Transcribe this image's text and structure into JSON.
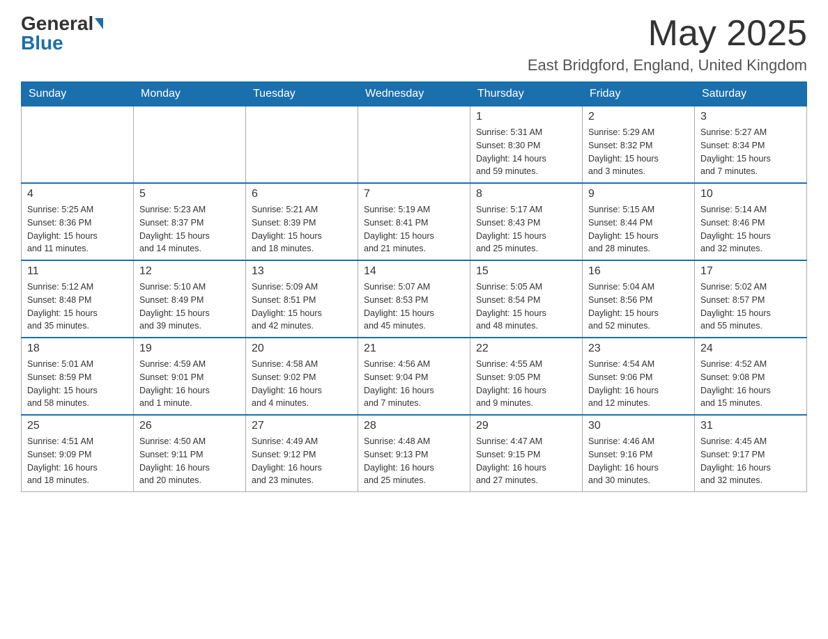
{
  "header": {
    "logo": {
      "general": "General",
      "blue": "Blue",
      "tagline": ""
    },
    "title": "May 2025",
    "location": "East Bridgford, England, United Kingdom"
  },
  "calendar": {
    "days_of_week": [
      "Sunday",
      "Monday",
      "Tuesday",
      "Wednesday",
      "Thursday",
      "Friday",
      "Saturday"
    ],
    "weeks": [
      [
        {
          "day": "",
          "info": ""
        },
        {
          "day": "",
          "info": ""
        },
        {
          "day": "",
          "info": ""
        },
        {
          "day": "",
          "info": ""
        },
        {
          "day": "1",
          "info": "Sunrise: 5:31 AM\nSunset: 8:30 PM\nDaylight: 14 hours\nand 59 minutes."
        },
        {
          "day": "2",
          "info": "Sunrise: 5:29 AM\nSunset: 8:32 PM\nDaylight: 15 hours\nand 3 minutes."
        },
        {
          "day": "3",
          "info": "Sunrise: 5:27 AM\nSunset: 8:34 PM\nDaylight: 15 hours\nand 7 minutes."
        }
      ],
      [
        {
          "day": "4",
          "info": "Sunrise: 5:25 AM\nSunset: 8:36 PM\nDaylight: 15 hours\nand 11 minutes."
        },
        {
          "day": "5",
          "info": "Sunrise: 5:23 AM\nSunset: 8:37 PM\nDaylight: 15 hours\nand 14 minutes."
        },
        {
          "day": "6",
          "info": "Sunrise: 5:21 AM\nSunset: 8:39 PM\nDaylight: 15 hours\nand 18 minutes."
        },
        {
          "day": "7",
          "info": "Sunrise: 5:19 AM\nSunset: 8:41 PM\nDaylight: 15 hours\nand 21 minutes."
        },
        {
          "day": "8",
          "info": "Sunrise: 5:17 AM\nSunset: 8:43 PM\nDaylight: 15 hours\nand 25 minutes."
        },
        {
          "day": "9",
          "info": "Sunrise: 5:15 AM\nSunset: 8:44 PM\nDaylight: 15 hours\nand 28 minutes."
        },
        {
          "day": "10",
          "info": "Sunrise: 5:14 AM\nSunset: 8:46 PM\nDaylight: 15 hours\nand 32 minutes."
        }
      ],
      [
        {
          "day": "11",
          "info": "Sunrise: 5:12 AM\nSunset: 8:48 PM\nDaylight: 15 hours\nand 35 minutes."
        },
        {
          "day": "12",
          "info": "Sunrise: 5:10 AM\nSunset: 8:49 PM\nDaylight: 15 hours\nand 39 minutes."
        },
        {
          "day": "13",
          "info": "Sunrise: 5:09 AM\nSunset: 8:51 PM\nDaylight: 15 hours\nand 42 minutes."
        },
        {
          "day": "14",
          "info": "Sunrise: 5:07 AM\nSunset: 8:53 PM\nDaylight: 15 hours\nand 45 minutes."
        },
        {
          "day": "15",
          "info": "Sunrise: 5:05 AM\nSunset: 8:54 PM\nDaylight: 15 hours\nand 48 minutes."
        },
        {
          "day": "16",
          "info": "Sunrise: 5:04 AM\nSunset: 8:56 PM\nDaylight: 15 hours\nand 52 minutes."
        },
        {
          "day": "17",
          "info": "Sunrise: 5:02 AM\nSunset: 8:57 PM\nDaylight: 15 hours\nand 55 minutes."
        }
      ],
      [
        {
          "day": "18",
          "info": "Sunrise: 5:01 AM\nSunset: 8:59 PM\nDaylight: 15 hours\nand 58 minutes."
        },
        {
          "day": "19",
          "info": "Sunrise: 4:59 AM\nSunset: 9:01 PM\nDaylight: 16 hours\nand 1 minute."
        },
        {
          "day": "20",
          "info": "Sunrise: 4:58 AM\nSunset: 9:02 PM\nDaylight: 16 hours\nand 4 minutes."
        },
        {
          "day": "21",
          "info": "Sunrise: 4:56 AM\nSunset: 9:04 PM\nDaylight: 16 hours\nand 7 minutes."
        },
        {
          "day": "22",
          "info": "Sunrise: 4:55 AM\nSunset: 9:05 PM\nDaylight: 16 hours\nand 9 minutes."
        },
        {
          "day": "23",
          "info": "Sunrise: 4:54 AM\nSunset: 9:06 PM\nDaylight: 16 hours\nand 12 minutes."
        },
        {
          "day": "24",
          "info": "Sunrise: 4:52 AM\nSunset: 9:08 PM\nDaylight: 16 hours\nand 15 minutes."
        }
      ],
      [
        {
          "day": "25",
          "info": "Sunrise: 4:51 AM\nSunset: 9:09 PM\nDaylight: 16 hours\nand 18 minutes."
        },
        {
          "day": "26",
          "info": "Sunrise: 4:50 AM\nSunset: 9:11 PM\nDaylight: 16 hours\nand 20 minutes."
        },
        {
          "day": "27",
          "info": "Sunrise: 4:49 AM\nSunset: 9:12 PM\nDaylight: 16 hours\nand 23 minutes."
        },
        {
          "day": "28",
          "info": "Sunrise: 4:48 AM\nSunset: 9:13 PM\nDaylight: 16 hours\nand 25 minutes."
        },
        {
          "day": "29",
          "info": "Sunrise: 4:47 AM\nSunset: 9:15 PM\nDaylight: 16 hours\nand 27 minutes."
        },
        {
          "day": "30",
          "info": "Sunrise: 4:46 AM\nSunset: 9:16 PM\nDaylight: 16 hours\nand 30 minutes."
        },
        {
          "day": "31",
          "info": "Sunrise: 4:45 AM\nSunset: 9:17 PM\nDaylight: 16 hours\nand 32 minutes."
        }
      ]
    ]
  }
}
